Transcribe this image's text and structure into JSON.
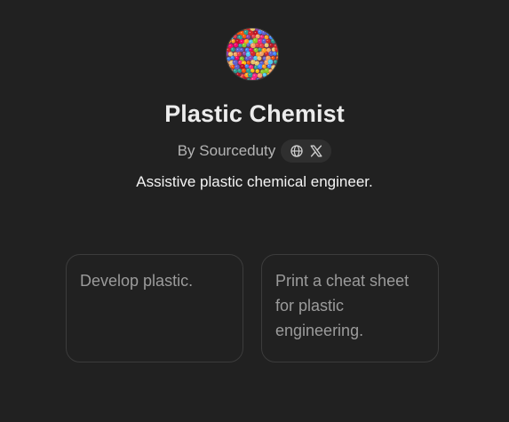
{
  "gpt": {
    "avatar": "plastic-beads-image",
    "name": "Plastic Chemist",
    "author_label": "By Sourceduty",
    "social_icons": [
      "globe-icon",
      "x-logo-icon"
    ],
    "description": "Assistive plastic chemical engineer."
  },
  "starters": [
    {
      "text": "Develop plastic."
    },
    {
      "text": "Print a cheat sheet for plastic engineering."
    }
  ],
  "colors": {
    "background": "#212121",
    "card_border": "#3c3c3c",
    "pill_background": "#2f2f2f",
    "title_text": "#ececec",
    "muted_text": "#9b9b9b"
  }
}
